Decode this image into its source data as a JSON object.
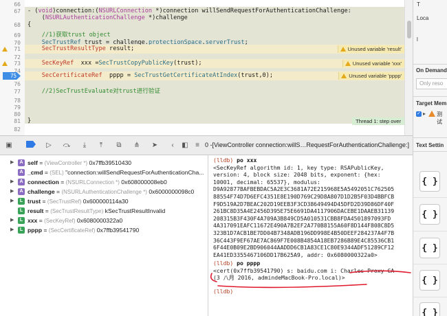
{
  "editor": {
    "lines": [
      {
        "num": "66",
        "tokens": []
      },
      {
        "num": "67",
        "tokens": [
          {
            "t": "- (",
            "c": "plain"
          },
          {
            "t": "void",
            "c": "purple"
          },
          {
            "t": ")connection:(",
            "c": "plain"
          },
          {
            "t": "NSURLConnection",
            "c": "purple"
          },
          {
            "t": " *)connection willSendRequestForAuthenticationChallenge:",
            "c": "plain"
          }
        ]
      },
      {
        "num": "",
        "tokens": [
          {
            "t": "    (",
            "c": "plain"
          },
          {
            "t": "NSURLAuthenticationChallenge",
            "c": "purple"
          },
          {
            "t": " *)challenge",
            "c": "plain"
          }
        ]
      },
      {
        "num": "68",
        "tokens": [
          {
            "t": "{",
            "c": "plain"
          }
        ]
      },
      {
        "num": "69",
        "tokens": [
          {
            "t": "    //1)获取trust object",
            "c": "green"
          }
        ]
      },
      {
        "num": "70",
        "tokens": [
          {
            "t": "    ",
            "c": "plain"
          },
          {
            "t": "SecTrustRef",
            "c": "teal",
            "u": true
          },
          {
            "t": " trust = challenge.",
            "c": "plain"
          },
          {
            "t": "protectionSpace",
            "c": "teal"
          },
          {
            "t": ".",
            "c": "plain"
          },
          {
            "t": "serverTrust",
            "c": "teal"
          },
          {
            "t": ";",
            "c": "plain"
          }
        ]
      },
      {
        "num": "71",
        "tokens": [
          {
            "t": "    ",
            "c": "plain"
          },
          {
            "t": "SecTrustResultType",
            "c": "red"
          },
          {
            "t": " result;",
            "c": "plain"
          }
        ],
        "warning": "Unused variable 'result'"
      },
      {
        "num": "72",
        "tokens": []
      },
      {
        "num": "73",
        "tokens": [
          {
            "t": "    ",
            "c": "plain"
          },
          {
            "t": "SecKeyRef",
            "c": "red"
          },
          {
            "t": "  xxx =",
            "c": "plain"
          },
          {
            "t": "SecTrustCopyPublicKey",
            "c": "teal"
          },
          {
            "t": "(trust);",
            "c": "plain"
          }
        ],
        "warning": "Unused variable 'xxx'"
      },
      {
        "num": "74",
        "tokens": []
      },
      {
        "num": "75",
        "tokens": [
          {
            "t": "    ",
            "c": "plain"
          },
          {
            "t": "SecCertificateRef",
            "c": "red"
          },
          {
            "t": "  pppp = ",
            "c": "plain"
          },
          {
            "t": "SecTrustGetCertificateAtIndex",
            "c": "teal"
          },
          {
            "t": "(trust,0);",
            "c": "plain"
          }
        ],
        "warning": "Unused variable 'pppp'",
        "breakpoint": true
      },
      {
        "num": "76",
        "tokens": []
      },
      {
        "num": "77",
        "tokens": [
          {
            "t": "    //2)SecTrustEvaluate对trust进行验证",
            "c": "green"
          }
        ]
      },
      {
        "num": "78",
        "tokens": []
      },
      {
        "num": "79",
        "tokens": []
      },
      {
        "num": "80",
        "tokens": []
      },
      {
        "num": "81",
        "tokens": [
          {
            "t": "}",
            "c": "plain"
          }
        ],
        "thread": "Thread 1: step over"
      },
      {
        "num": "82",
        "tokens": []
      }
    ]
  },
  "inspector": {
    "top_items": [
      "T",
      "Loca",
      "l"
    ],
    "on_demand_heading": "On Demand",
    "only_resources_placeholder": "Only reso",
    "target_heading": "Target Mem",
    "target_item_label": "测试",
    "text_settings_heading": "Text Settin"
  },
  "debug_bar": {
    "path_index": "0",
    "path_text": "-[ViewController connection:willS…RequestForAuthenticationChallenge:]"
  },
  "variables": [
    {
      "badge": "A",
      "name": "self",
      "type": "(ViewController *)",
      "value": "0x7ffb39510430",
      "expandable": true
    },
    {
      "badge": "A",
      "name": "_cmd",
      "type": "(SEL)",
      "value": "\"connection:willSendRequestForAuthenticationCha...",
      "expandable": false
    },
    {
      "badge": "A",
      "name": "connection",
      "type": "(NSURLConnection *)",
      "value": "0x608000008eb0",
      "expandable": true
    },
    {
      "badge": "A",
      "name": "challenge",
      "type": "(NSURLAuthenticationChallenge *)",
      "value": "0x6000000098c0",
      "expandable": true
    },
    {
      "badge": "L",
      "name": "trust",
      "type": "(SecTrustRef)",
      "value": "0x600000114a30",
      "expandable": true
    },
    {
      "badge": "L",
      "name": "result",
      "type": "(SecTrustResultType)",
      "value": "kSecTrustResultInvalid",
      "expandable": false
    },
    {
      "badge": "L",
      "name": "xxx",
      "type": "(SecKeyRef)",
      "value": "0x6080000322a0",
      "expandable": true
    },
    {
      "badge": "L",
      "name": "pppp",
      "type": "(SecCertificateRef)",
      "value": "0x7ffb39541790",
      "expandable": true
    }
  ],
  "console": {
    "prompt": "(lldb)",
    "cmd1": "po xxx",
    "output1": [
      "<SecKeyRef algorithm id: 1, key type: RSAPublicKey,",
      "version: 4, block size: 2048 bits, exponent: {hex:",
      "10001, decimal: 65537}, modulus:",
      "D9A92877BAFBEBDAC5A2E3C3681A72E215968E5A5492051C762505",
      "88554F74D7D6EFC4351E8E190D769C29D8A807D1D2B5F03D4BBFCB",
      "F9D519A2D7BEAC202D19EEB3F3CD38649494D45DFD2D39D86DF40F",
      "261BC8D35A4E2456D395E75E6691DA4117906DACEBE1DAAEB31139",
      "208315B3F430F4A709A3B849CD5A010531CBB8FDA4501897093FD",
      "4A317091EAFC11672E490A7B2EF2A770B8155A60F8D144F808C8D5",
      "323B1D7ACB1BE7DD04B7348ADB196DD998E4B50DEEF284237A4F7B",
      "36C443F9EF67AE7AC869F7E008B4854A18EB7286B89E4C85536CB1",
      "6F44E0B09E2BD906044AADDD6CB1A83CE1C80E9344ADF51289CF12",
      "EA41ED3355467106DD17B625A9, addr: 0x6080000322a0>"
    ],
    "cmd2": "po pppp",
    "output2": [
      "<cert(0x7ffb39541790) s: baidu.com i: Charles Proxy CA",
      "(3 八月 2016, admindeMacBook-Pro.local)>"
    ],
    "prompt_last": "(lldb)"
  },
  "colors": {
    "accent": "#3f8ee6",
    "warning": "#e3a918",
    "annotation_ink": "#e0182c",
    "stack_tint": "#e4e4d4"
  }
}
